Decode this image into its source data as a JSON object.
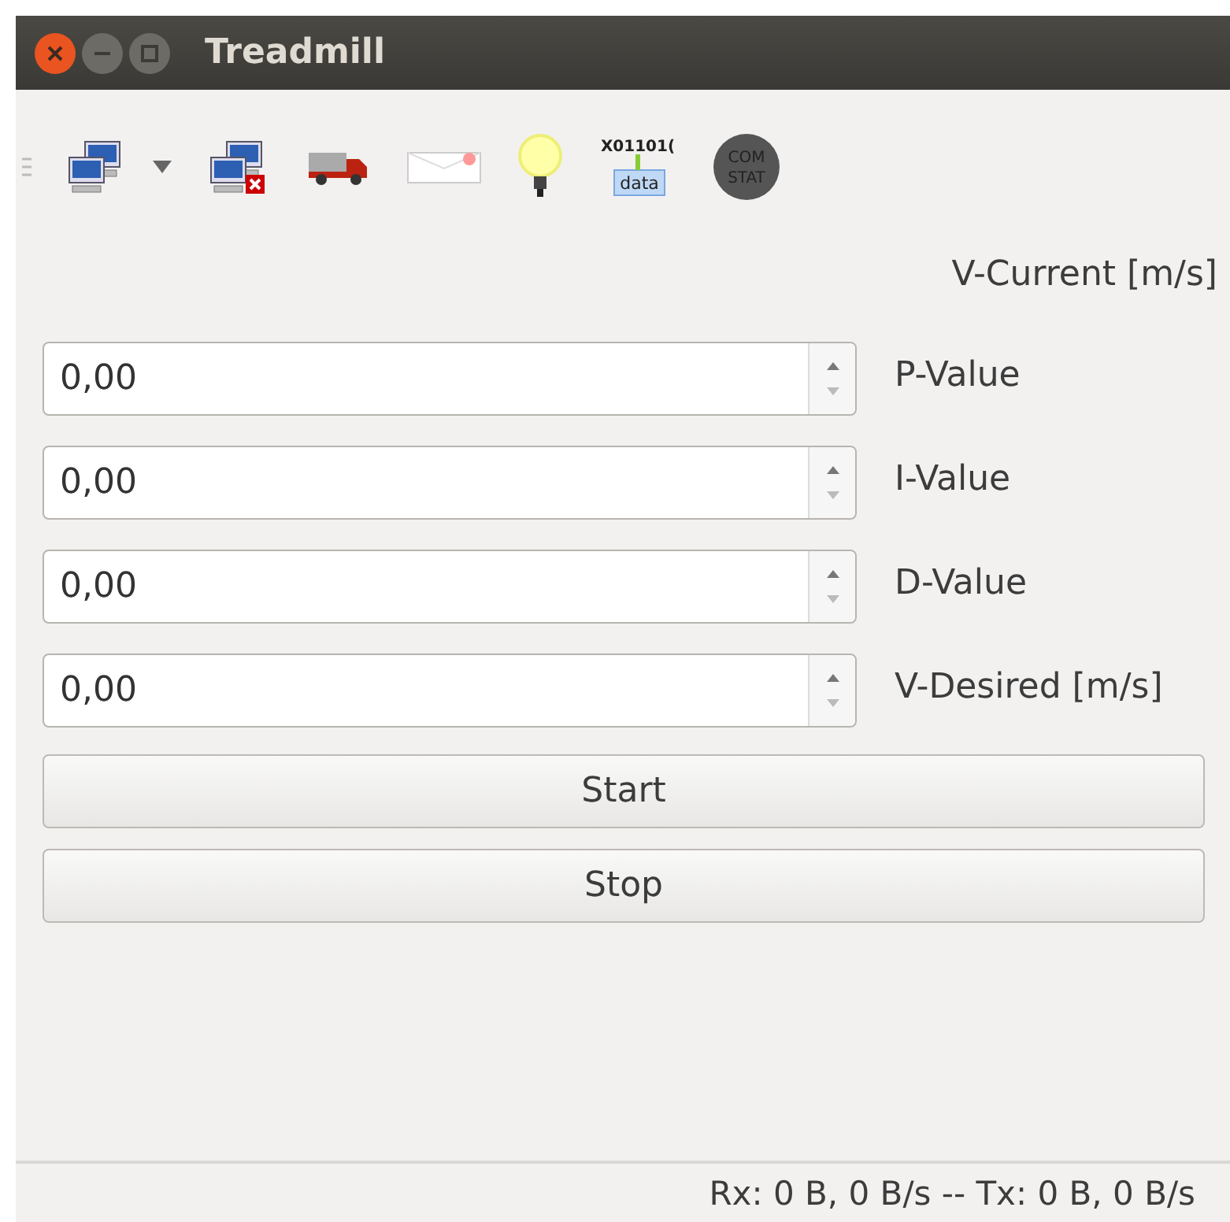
{
  "window": {
    "title": "Treadmill"
  },
  "toolbar": [
    {
      "kind": "connect"
    },
    {
      "kind": "dropdown"
    },
    {
      "kind": "disconnect"
    },
    {
      "kind": "truck"
    },
    {
      "kind": "envelope"
    },
    {
      "kind": "bulb"
    },
    {
      "kind": "data",
      "texts": [
        "X01101(",
        "data"
      ]
    },
    {
      "kind": "comstat",
      "texts": [
        "COM",
        "STAT"
      ]
    }
  ],
  "current_label": "V-Current [m/s]",
  "fields": [
    {
      "value": "0,00",
      "label": "P-Value"
    },
    {
      "value": "0,00",
      "label": "I-Value"
    },
    {
      "value": "0,00",
      "label": "D-Value"
    },
    {
      "value": "0,00",
      "label": "V-Desired [m/s]"
    }
  ],
  "buttons": [
    "Start",
    "Stop"
  ],
  "status_bar": "Rx: 0 B, 0 B/s -- Tx: 0 B, 0 B/s"
}
